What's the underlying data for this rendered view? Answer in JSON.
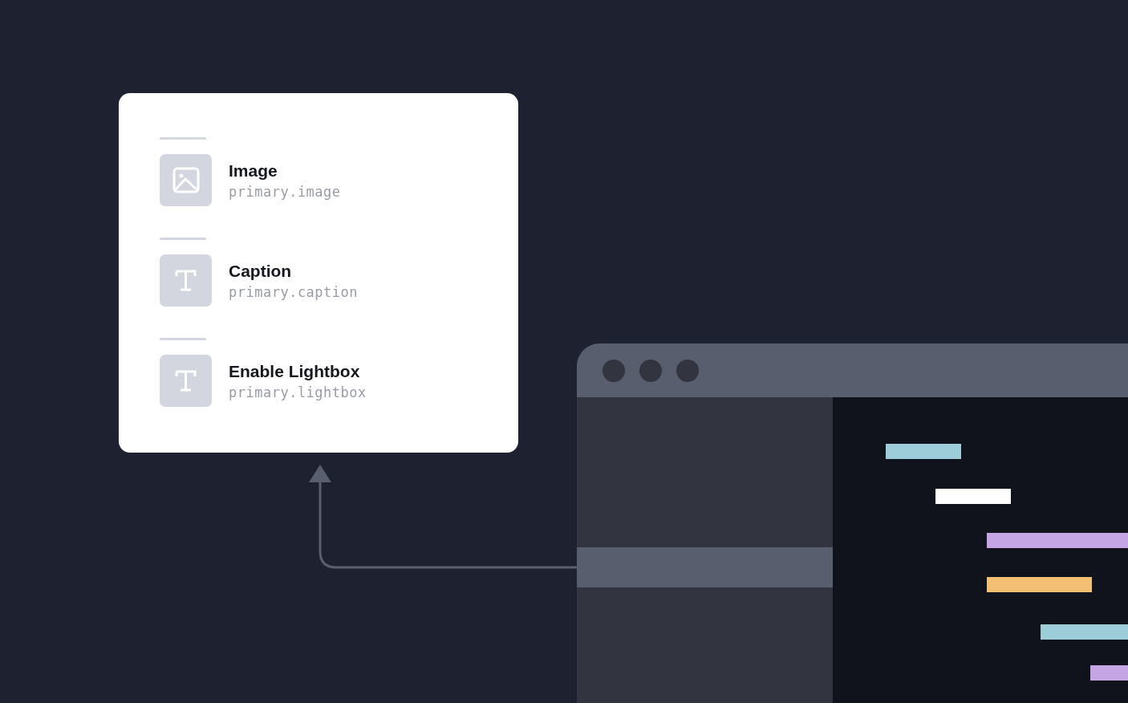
{
  "fields_card": {
    "fields": [
      {
        "kind": "image",
        "label": "Image",
        "path": "primary.image"
      },
      {
        "kind": "text",
        "label": "Caption",
        "path": "primary.caption"
      },
      {
        "kind": "text",
        "label": "Enable Lightbox",
        "path": "primary.lightbox"
      }
    ]
  },
  "browser_window": {
    "sidebar_rows": [
      {
        "selected": false
      },
      {
        "selected": true
      },
      {
        "selected": false
      }
    ],
    "code_lines": [
      {
        "color": "#9ccdd9"
      },
      {
        "color": "#ffffff"
      },
      {
        "color": "#c5a5e4"
      },
      {
        "color": "#f2bf73"
      },
      {
        "color": "#9ccdd9"
      },
      {
        "color": "#c5a5e4"
      }
    ]
  }
}
